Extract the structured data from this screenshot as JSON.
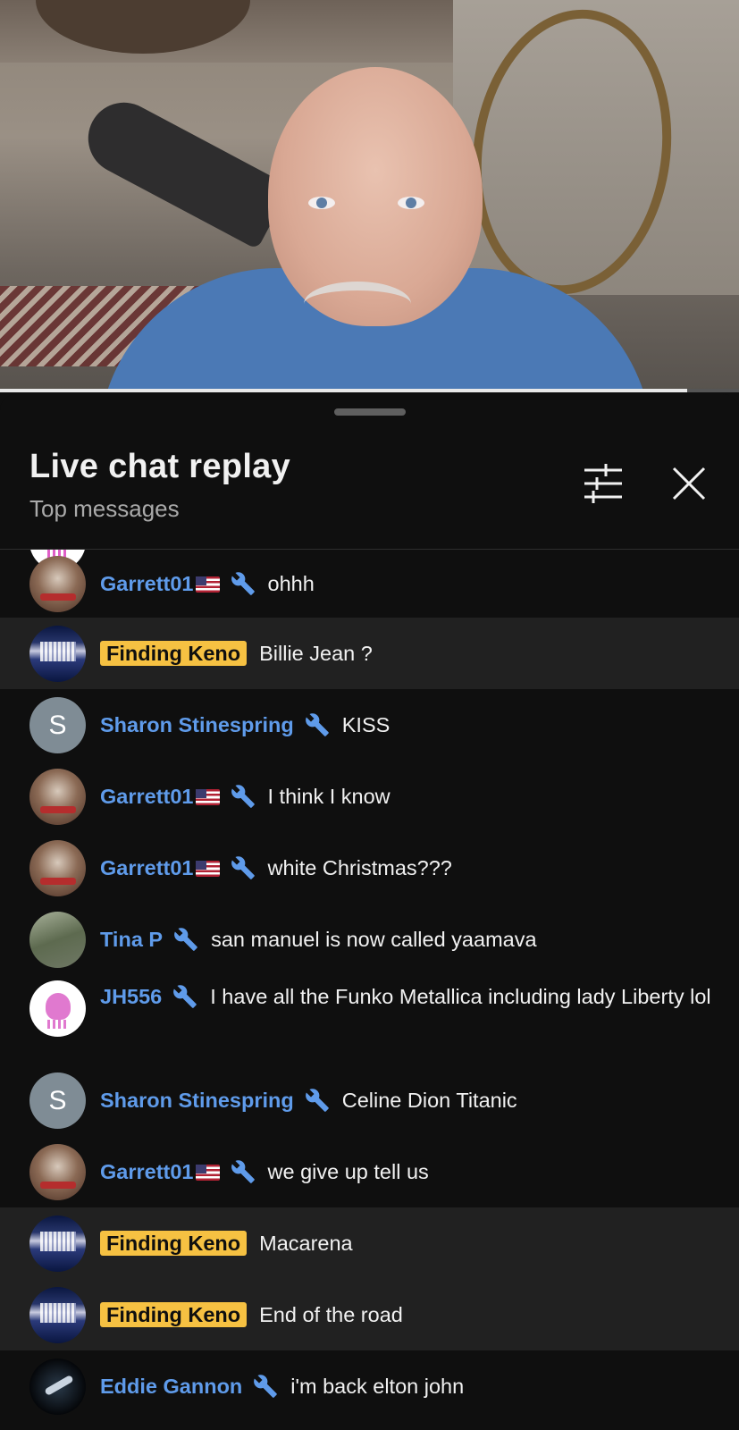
{
  "video": {
    "progress_fraction": 0.93
  },
  "sheet": {
    "title": "Live chat replay",
    "subtitle": "Top messages",
    "filter_icon": "tune-icon",
    "close_icon": "close-icon"
  },
  "messages": [
    {
      "author": "Garrett01",
      "flag": true,
      "moderator": true,
      "member_badge": false,
      "text": "ohhh",
      "avatar": "garrett",
      "highlighted": false
    },
    {
      "author": "Finding Keno",
      "flag": false,
      "moderator": false,
      "member_badge": true,
      "text": "Billie Jean ?",
      "avatar": "keno",
      "highlighted": true
    },
    {
      "author": "Sharon Stinespring",
      "flag": false,
      "moderator": true,
      "member_badge": false,
      "text": "KISS",
      "avatar": "s",
      "avatar_letter": "S",
      "highlighted": false
    },
    {
      "author": "Garrett01",
      "flag": true,
      "moderator": true,
      "member_badge": false,
      "text": "I think I know",
      "avatar": "garrett",
      "highlighted": false
    },
    {
      "author": "Garrett01",
      "flag": true,
      "moderator": true,
      "member_badge": false,
      "text": "white Christmas???",
      "avatar": "garrett",
      "highlighted": false
    },
    {
      "author": "Tina P",
      "flag": false,
      "moderator": true,
      "member_badge": false,
      "text": "san manuel is now called yaamava",
      "avatar": "tina",
      "highlighted": false
    },
    {
      "author": "JH556",
      "flag": false,
      "moderator": true,
      "member_badge": false,
      "text": "I have all the Funko Metallica including lady Liberty lol",
      "avatar": "jh",
      "highlighted": false
    },
    {
      "author": "Sharon Stinespring",
      "flag": false,
      "moderator": true,
      "member_badge": false,
      "text": "Celine Dion Titanic",
      "avatar": "s",
      "avatar_letter": "S",
      "highlighted": false
    },
    {
      "author": "Garrett01",
      "flag": true,
      "moderator": true,
      "member_badge": false,
      "text": "we give up tell us",
      "avatar": "garrett",
      "highlighted": false
    },
    {
      "author": "Finding Keno",
      "flag": false,
      "moderator": false,
      "member_badge": true,
      "text": "Macarena",
      "avatar": "keno",
      "highlighted": true
    },
    {
      "author": "Finding Keno",
      "flag": false,
      "moderator": false,
      "member_badge": true,
      "text": "End of the road",
      "avatar": "keno",
      "highlighted": true
    },
    {
      "author": "Eddie Gannon",
      "flag": false,
      "moderator": true,
      "member_badge": false,
      "text": "i'm back elton john",
      "avatar": "eddie",
      "highlighted": false
    }
  ]
}
